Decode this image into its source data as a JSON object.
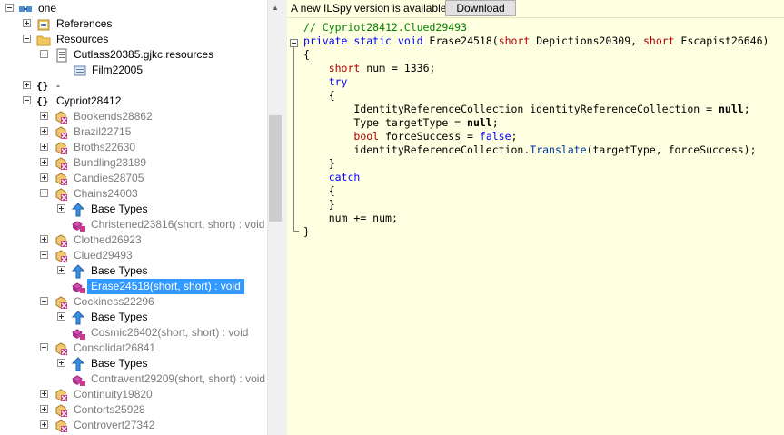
{
  "banner": {
    "message": "A new ILSpy version is available.",
    "download_label": "Download"
  },
  "tree": {
    "rows": [
      {
        "label": "one"
      },
      {
        "label": "References"
      },
      {
        "label": "Resources"
      },
      {
        "label": "Cutlass20385.gjkc.resources"
      },
      {
        "label": "Film22005"
      },
      {
        "label": "-"
      },
      {
        "label": "Cypriot28412"
      },
      {
        "label": "Bookends28862"
      },
      {
        "label": "Brazil22715"
      },
      {
        "label": "Broths22630"
      },
      {
        "label": "Bundling23189"
      },
      {
        "label": "Candies28705"
      },
      {
        "label": "Chains24003"
      },
      {
        "label": "Base Types"
      },
      {
        "label": "Christened23816(short, short) : void"
      },
      {
        "label": "Clothed26923"
      },
      {
        "label": "Clued29493"
      },
      {
        "label": "Base Types"
      },
      {
        "label": "Erase24518(short, short) : void"
      },
      {
        "label": "Cockiness22296"
      },
      {
        "label": "Base Types"
      },
      {
        "label": "Cosmic26402(short, short) : void"
      },
      {
        "label": "Consolidat26841"
      },
      {
        "label": "Base Types"
      },
      {
        "label": "Contravent29209(short, short) : void"
      },
      {
        "label": "Continuity19820"
      },
      {
        "label": "Contorts25928"
      },
      {
        "label": "Controvert27342"
      }
    ]
  },
  "code": {
    "comment": "// Cypriot28412.Clued29493",
    "l_private": "private",
    "l_static": "static",
    "l_void": "void",
    "l_method": "Erase24518(",
    "l_short1": "short",
    "l_param1": "Depictions20309,",
    "l_short2": "short",
    "l_param2": "Escapist26646)",
    "ob1": "{",
    "l3_short": "short",
    "l3_rest": "num = 1336;",
    "l_try": "try",
    "ob2": "{",
    "l5_a": "IdentityReferenceCollection identityReferenceCollection =",
    "l5_null": "null",
    "l5_end": ";",
    "l6_a": "Type targetType =",
    "l6_null": "null",
    "l6_end": ";",
    "l7_bool": "bool",
    "l7_a": "forceSuccess =",
    "l7_false": "false",
    "l7_end": ";",
    "l8_a": "identityReferenceCollection.",
    "l8_method": "Translate",
    "l8_b": "(targetType, forceSuccess);",
    "cb2": "}",
    "l_catch": "catch",
    "ob3": "{",
    "cb3": "}",
    "l_numplus": "num += num;",
    "cb1": "}"
  }
}
